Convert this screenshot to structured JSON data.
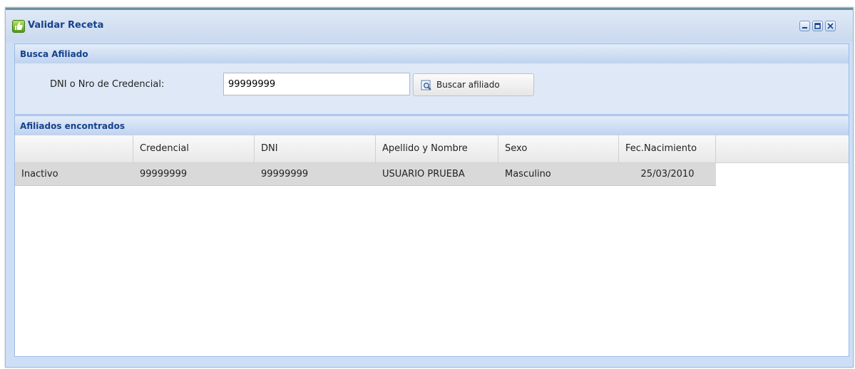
{
  "window": {
    "title": "Validar Receta",
    "tools": [
      "minimize-icon",
      "maximize-icon",
      "close-icon"
    ]
  },
  "search_panel": {
    "title": "Busca Afiliado",
    "field_label": "DNI o Nro de Credencial:",
    "field_value": "99999999",
    "button_label": "Buscar afiliado"
  },
  "results_panel": {
    "title": "Afiliados encontrados",
    "columns": [
      "",
      "Credencial",
      "DNI",
      "Apellido y Nombre",
      "Sexo",
      "Fec.Nacimiento"
    ],
    "rows": [
      [
        "Inactivo",
        "99999999",
        "99999999",
        "USUARIO PRUEBA",
        "Masculino",
        "25/03/2010"
      ]
    ]
  },
  "colors": {
    "title_text": "#15428b",
    "panel_border": "#99bbe8",
    "row_selected": "#d9d9d9"
  }
}
